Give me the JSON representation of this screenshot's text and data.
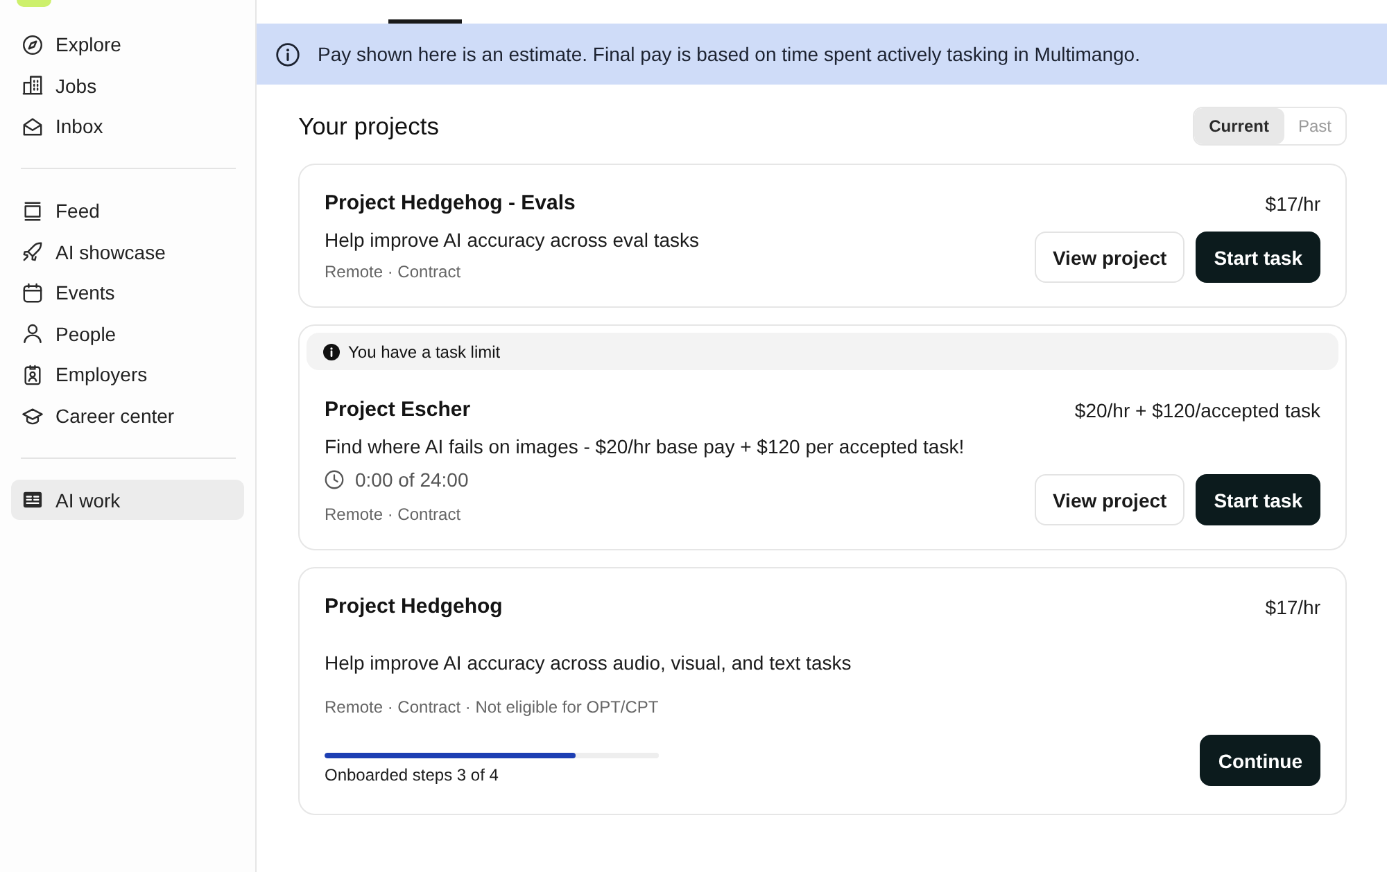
{
  "sidebar": {
    "groups": [
      {
        "items": [
          {
            "label": "Explore",
            "selected": false
          },
          {
            "label": "Jobs",
            "selected": false
          },
          {
            "label": "Inbox",
            "selected": false
          }
        ]
      },
      {
        "items": [
          {
            "label": "Feed",
            "selected": false
          },
          {
            "label": "AI showcase",
            "selected": false
          },
          {
            "label": "Events",
            "selected": false
          },
          {
            "label": "People",
            "selected": false
          },
          {
            "label": "Employers",
            "selected": false
          },
          {
            "label": "Career center",
            "selected": false
          }
        ]
      },
      {
        "items": [
          {
            "label": "AI work",
            "selected": true
          }
        ]
      }
    ]
  },
  "banner": {
    "text": "Pay shown here is an estimate. Final pay is based on time spent actively tasking in Multimango."
  },
  "projects": {
    "title": "Your projects",
    "filters": [
      {
        "label": "Current",
        "selected": true
      },
      {
        "label": "Past",
        "selected": false
      }
    ],
    "cards": [
      {
        "title": "Project Hedgehog - Evals",
        "pay": "$17/hr",
        "description": "Help improve AI accuracy across eval tasks",
        "meta": "Remote · Contract",
        "buttons": [
          {
            "label": "View project",
            "kind": "secondary"
          },
          {
            "label": "Start task",
            "kind": "primary"
          }
        ]
      },
      {
        "notice": "You have a task limit",
        "title": "Project Escher",
        "pay": "$20/hr + $120/accepted task",
        "description": "Find where AI fails on images - $20/hr base pay + $120 per accepted task!",
        "timer": "0:00 of 24:00",
        "meta": "Remote · Contract",
        "buttons": [
          {
            "label": "View project",
            "kind": "secondary"
          },
          {
            "label": "Start task",
            "kind": "primary"
          }
        ]
      },
      {
        "title": "Project Hedgehog",
        "pay": "$17/hr",
        "description": "Help improve AI accuracy across audio, visual, and text tasks",
        "meta": "Remote · Contract · Not eligible for OPT/CPT",
        "progress": {
          "level": 0.75,
          "label": "Onboarded steps 3 of 4"
        },
        "buttons": [
          {
            "label": "Continue",
            "kind": "primary"
          }
        ]
      }
    ]
  }
}
